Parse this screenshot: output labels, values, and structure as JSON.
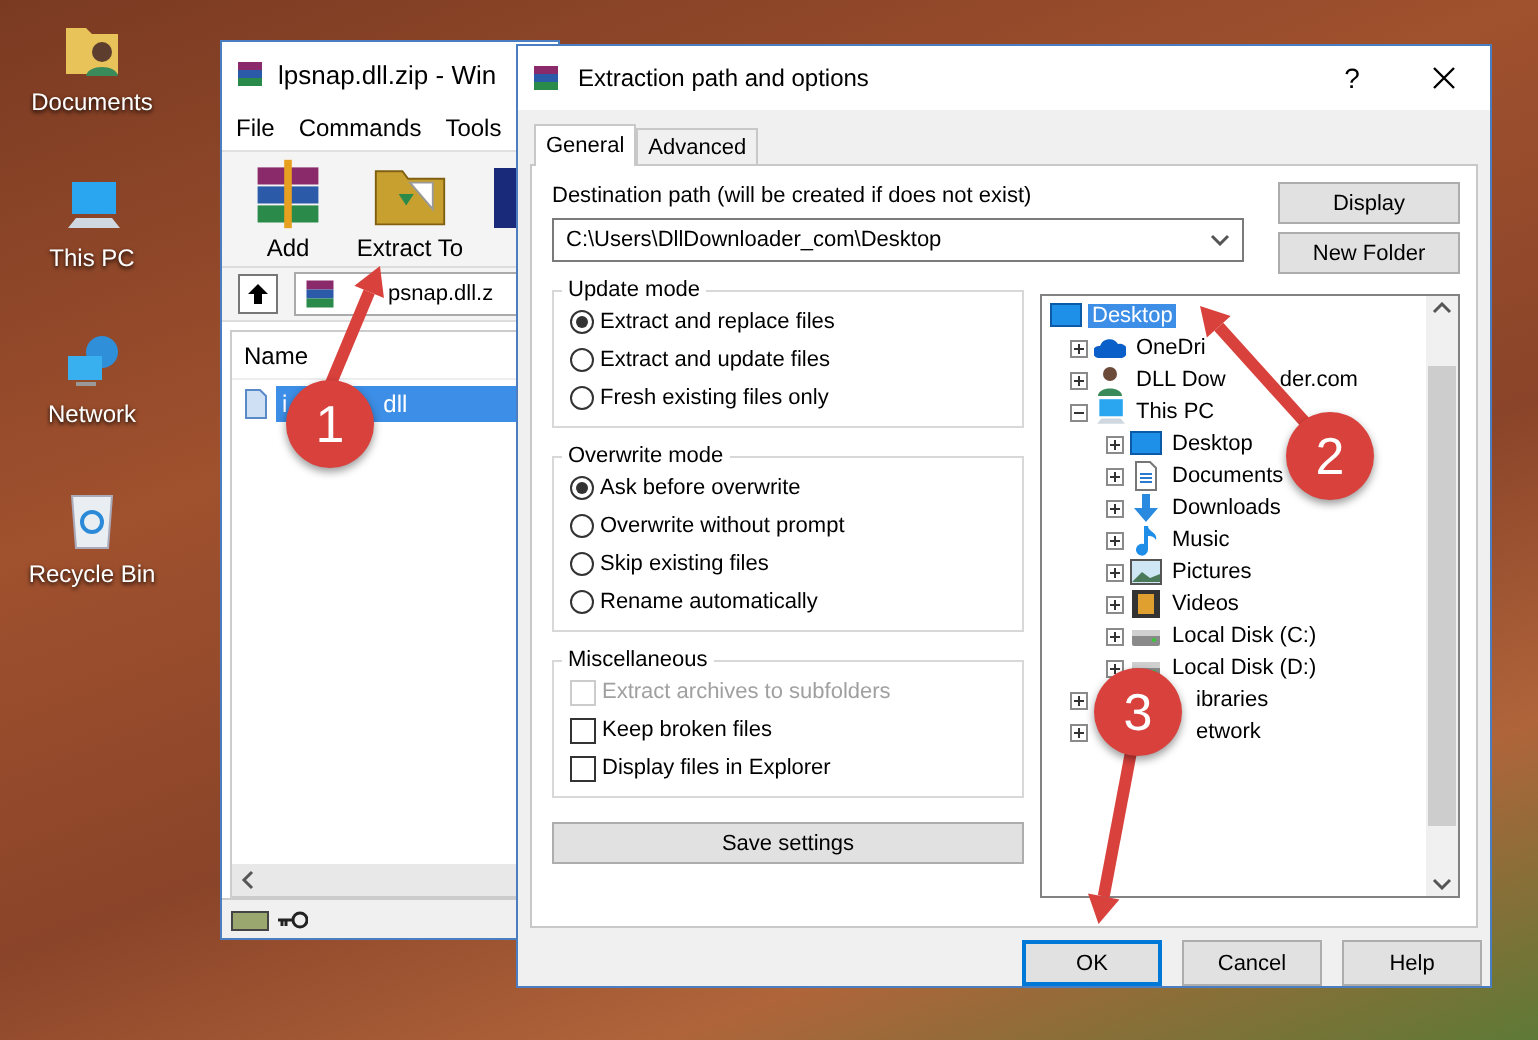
{
  "desktop": {
    "icons": [
      {
        "label": "Documents",
        "kind": "user-folder"
      },
      {
        "label": "This PC",
        "kind": "pc"
      },
      {
        "label": "Network",
        "kind": "network"
      },
      {
        "label": "Recycle Bin",
        "kind": "bin"
      }
    ]
  },
  "archiver": {
    "title": "lpsnap.dll.zip - Win",
    "menu": [
      "File",
      "Commands",
      "Tools"
    ],
    "toolbar": [
      {
        "label": "Add",
        "kind": "add"
      },
      {
        "label": "Extract To",
        "kind": "extract"
      }
    ],
    "address": "psnap.dll.z",
    "column_1": "Name",
    "files": [
      {
        "name_start": "i",
        "name_end": "dll",
        "selected": true
      }
    ]
  },
  "dialog": {
    "title": "Extraction path and options",
    "help": "?",
    "tabs": [
      {
        "label": "General",
        "selected": true
      },
      {
        "label": "Advanced",
        "selected": false
      }
    ],
    "destination_label": "Destination path (will be created if does not exist)",
    "destination_value": "C:\\Users\\DllDownloader_com\\Desktop",
    "side_buttons": [
      "Display",
      "New Folder"
    ],
    "groups": [
      {
        "title": "Update mode",
        "kind": "radio",
        "options": [
          {
            "label": "Extract and replace files",
            "checked": true,
            "disabled": false
          },
          {
            "label": "Extract and update files",
            "checked": false,
            "disabled": false
          },
          {
            "label": "Fresh existing files only",
            "checked": false,
            "disabled": false
          }
        ]
      },
      {
        "title": "Overwrite mode",
        "kind": "radio",
        "options": [
          {
            "label": "Ask before overwrite",
            "checked": true,
            "disabled": false
          },
          {
            "label": "Overwrite without prompt",
            "checked": false,
            "disabled": false
          },
          {
            "label": "Skip existing files",
            "checked": false,
            "disabled": false
          },
          {
            "label": "Rename automatically",
            "checked": false,
            "disabled": false
          }
        ]
      },
      {
        "title": "Miscellaneous",
        "kind": "checkbox",
        "options": [
          {
            "label": "Extract archives to subfolders",
            "checked": false,
            "disabled": true
          },
          {
            "label": "Keep broken files",
            "checked": false,
            "disabled": false
          },
          {
            "label": "Display files in Explorer",
            "checked": false,
            "disabled": false
          }
        ]
      }
    ],
    "save_button": "Save settings",
    "tree": [
      {
        "label": "Desktop",
        "kind": "desktop",
        "selected": true,
        "children": [
          {
            "label": "OneDri",
            "kind": "cloud",
            "selected": false,
            "expanded": false
          },
          {
            "label": "DLL Dow",
            "label_tail": "der.com",
            "kind": "user",
            "selected": false,
            "expanded": false
          },
          {
            "label": "This PC",
            "kind": "pc",
            "selected": false,
            "expanded": true,
            "children": [
              {
                "label": "Desktop",
                "kind": "desktop",
                "selected": false,
                "expanded": false
              },
              {
                "label": "Documents",
                "kind": "docs",
                "selected": false,
                "expanded": false
              },
              {
                "label": "Downloads",
                "kind": "download",
                "selected": false,
                "expanded": false
              },
              {
                "label": "Music",
                "kind": "music",
                "selected": false,
                "expanded": false
              },
              {
                "label": "Pictures",
                "kind": "pictures",
                "selected": false,
                "expanded": false
              },
              {
                "label": "Videos",
                "kind": "videos",
                "selected": false,
                "expanded": false
              },
              {
                "label": "Local Disk (C:)",
                "kind": "disk",
                "selected": false,
                "expanded": false
              },
              {
                "label": "Local Disk (D:)",
                "kind": "disk",
                "selected": false,
                "expanded": false
              }
            ]
          },
          {
            "label": "ibraries",
            "selected": false,
            "expanded": false
          },
          {
            "label": "etwork",
            "selected": false,
            "expanded": false
          }
        ]
      }
    ],
    "footer_buttons": [
      {
        "label": "OK",
        "default": true
      },
      {
        "label": "Cancel",
        "default": false
      },
      {
        "label": "Help",
        "default": false
      }
    ]
  },
  "callouts": [
    {
      "number": "1"
    },
    {
      "number": "2"
    },
    {
      "number": "3"
    }
  ]
}
